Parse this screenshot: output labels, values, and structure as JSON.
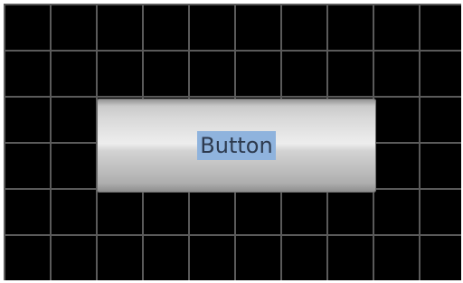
{
  "button": {
    "label": "Button"
  },
  "colors": {
    "canvas_background": "#000000",
    "grid_lines": "#5a5a5a",
    "text_selection": "#8fb3dd",
    "label_text": "#2d3a4e"
  }
}
